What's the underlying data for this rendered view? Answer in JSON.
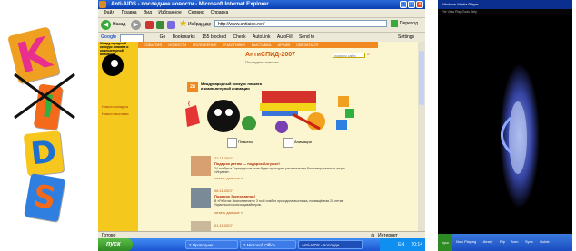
{
  "kids_logo": {
    "letters": [
      "K",
      "I",
      "D",
      "S"
    ]
  },
  "ie": {
    "title": "Anti-AIDS - последние новости - Microsoft Internet Explorer",
    "menu": [
      "Файл",
      "Правка",
      "Вид",
      "Избранное",
      "Сервис",
      "Справка"
    ],
    "back_label": "Назад",
    "favorites_label": "Избранное",
    "address_label": "Адрес:",
    "address_value": "http://www.antiaids.net/",
    "go_label": "Переход",
    "google_label": "Google",
    "gtool": [
      "Go",
      "Bookmarks",
      "155 blocked",
      "Check",
      "AutoLink",
      "AutoFill",
      "Send to",
      "Settings"
    ],
    "status_left": "Готово",
    "status_right": "Интернет"
  },
  "site": {
    "header_caption": "Международный конкурс плаката и компьютерной анимации",
    "nav": [
      "СОБЫТИЯ",
      "НОВОСТИ",
      "ПОЛОЖЕНИЕ",
      "УЧАСТНИКИ",
      "ВЫСТАВКА",
      "АРХИВ",
      "СВЯЗАТЬСЯ"
    ],
    "site_title": "АнтиСПИД-2007",
    "news_subtitle": "Последние новости",
    "search_placeholder": "поиск по сайту",
    "intro_line1": "Международный конкурс плаката",
    "intro_line2": "и компьютерной анимации",
    "badge": "2й",
    "left_links": [
      "Новости конкурса",
      "Новости выставки"
    ],
    "poster_label": "Плакаты",
    "anim_label": "Анимации",
    "news": [
      {
        "date": "22.11.2007",
        "title": "Подарок детям — подарок Ангушке!",
        "text": "24 ноября в Гарвардском зале будет проходить региональная благотворительная акция «Играем».",
        "more": "читать дальше »"
      },
      {
        "date": "08.11.2007",
        "title": "Подарок Экспонавтов!",
        "text": "В «Работах Экспонавтов» с 3 по 4 ноября проходила выставка, посвящённая 20-летию Украинского союза дизайнеров.",
        "more": "читать дальше »"
      },
      {
        "date": "01.11.2007",
        "title": "",
        "text": "",
        "more": ""
      }
    ]
  },
  "taskbar": {
    "start_label": "пуск",
    "items": [
      "2 Проводник",
      "2 Microsoft Office",
      "Anti-AIDS - последн..."
    ],
    "lang": "EN",
    "clock": "20:14"
  },
  "right_window": {
    "title": "Windows Media Player",
    "toolbar": "File  View  Play  Tools  Help",
    "task_items": [
      "пуск",
      "Now Playing",
      "Library",
      "Rip",
      "Burn",
      "Sync",
      "Guide"
    ]
  }
}
